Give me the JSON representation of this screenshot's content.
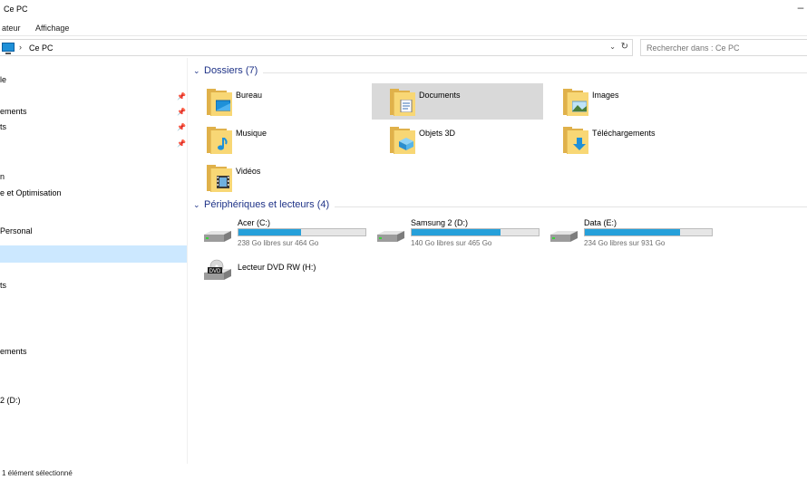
{
  "window": {
    "title": "Ce PC"
  },
  "ribbon": {
    "tabs": [
      "ateur",
      "Affichage"
    ]
  },
  "address": {
    "separator": "›",
    "crumb": "Ce PC",
    "dropdown": "⌄",
    "refresh": "↻"
  },
  "search": {
    "placeholder": "Rechercher dans : Ce PC"
  },
  "nav": {
    "items": [
      {
        "label": "le",
        "pinned": false
      },
      {
        "label": "",
        "pinned": true
      },
      {
        "label": "ements",
        "pinned": true
      },
      {
        "label": "ts",
        "pinned": true
      },
      {
        "label": "",
        "pinned": true
      },
      {
        "label": "n",
        "pinned": false
      },
      {
        "label": "e et Optimisation",
        "pinned": false
      },
      {
        "label": "Personal",
        "pinned": false
      },
      {
        "label": "",
        "pinned": false,
        "selected": true
      },
      {
        "label": "ts",
        "pinned": false
      },
      {
        "label": "ements",
        "pinned": false
      },
      {
        "label": "2  (D:)",
        "pinned": false
      }
    ]
  },
  "folders": {
    "header": "Dossiers (7)",
    "items": [
      {
        "label": "Bureau",
        "icon": "desktop-folder-icon"
      },
      {
        "label": "Documents",
        "icon": "documents-folder-icon",
        "selected": true
      },
      {
        "label": "Images",
        "icon": "pictures-folder-icon"
      },
      {
        "label": "Musique",
        "icon": "music-folder-icon"
      },
      {
        "label": "Objets 3D",
        "icon": "3d-objects-folder-icon"
      },
      {
        "label": "Téléchargements",
        "icon": "downloads-folder-icon"
      },
      {
        "label": "Vidéos",
        "icon": "videos-folder-icon"
      }
    ]
  },
  "devices": {
    "header": "Périphériques et lecteurs (4)",
    "items": [
      {
        "label": "Acer (C:)",
        "free": "238 Go libres sur 464 Go",
        "used_fraction": 0.49,
        "icon": "windows-drive-icon"
      },
      {
        "label": "Samsung 2  (D:)",
        "free": "140 Go libres sur 465 Go",
        "used_fraction": 0.7,
        "icon": "hard-drive-icon"
      },
      {
        "label": "Data (E:)",
        "free": "234 Go libres sur 931 Go",
        "used_fraction": 0.75,
        "icon": "hard-drive-icon"
      },
      {
        "label": "Lecteur DVD RW (H:)",
        "icon": "dvd-drive-icon",
        "badge": "DVD"
      }
    ]
  },
  "status": {
    "text": "1 élément sélectionné"
  },
  "colors": {
    "accent": "#1e3287",
    "bar": "#26a0da",
    "selection": "#cce8ff",
    "tile_selected": "#d9d9d9"
  }
}
